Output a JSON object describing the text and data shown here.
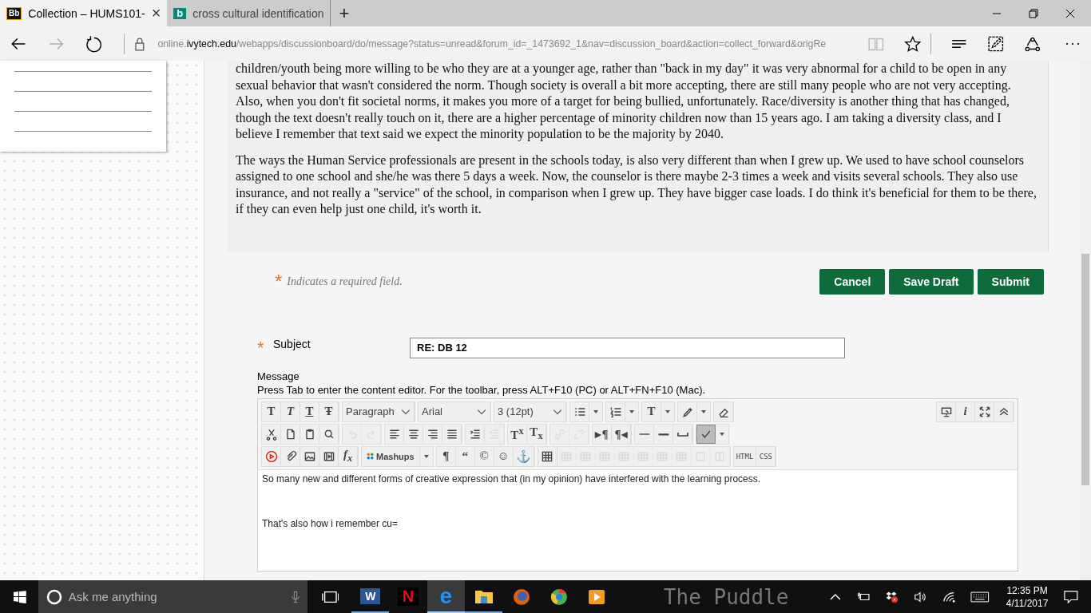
{
  "browser": {
    "tabs": [
      {
        "badge": "Bb",
        "title": "Collection – HUMS101-",
        "selected": true,
        "close": "×"
      },
      {
        "badge": "b",
        "title": "cross cultural identification",
        "selected": false
      }
    ],
    "new_tab": "+",
    "address": {
      "prefix": "online.",
      "domain": "ivytech.edu",
      "path": "/webapps/discussionboard/do/message?status=unread&forum_id=_1473692_1&nav=discussion_board&action=collect_forward&origRe"
    },
    "more": "···"
  },
  "post": {
    "paragraphs": [
      "children/youth being more willing to be who they are at a younger age, rather than \"back in my day\" it was very abnormal for a child to be open in any sexual behavior that wasn't considered the norm. Though society is overall a bit more accepting, there are still many people who are not very accepting. Also, when you don't fit societal norms, it makes you more of a target for being bullied, unfortunately. Race/diversity is another thing that has changed, though the text doesn't really touch on it, there are a higher percentage of minority children now than 15 years ago. I am taking a diversity class, and I believe I remember that text said we expect the minority population to be the majority by 2040.",
      "The ways the Human Service professionals are present in the schools today, is also very different than when I grew up. We used to have school counselors assigned to one school and she/he was there 5 days a week. Now, the counselor is there maybe 2-3 times a week and visits several schools. They also use insurance, and not really a \"service\" of the school, in comparison when I grew up. They have bigger case loads. I do think it's beneficial for them to be there, if they can even help just one child, it's worth it."
    ]
  },
  "form": {
    "required_mark": "*",
    "required_note": "Indicates a required field.",
    "buttons": [
      "Cancel",
      "Save Draft",
      "Submit"
    ],
    "subject": {
      "mark": "*",
      "label": "Subject",
      "value": "RE: DB 12"
    },
    "message": {
      "label": "Message",
      "hint": "Press Tab to enter the content editor. For the toolbar, press ALT+F10 (PC) or ALT+FN+F10 (Mac)."
    }
  },
  "toolbar": {
    "rows": [
      {
        "groups": [
          [
            {
              "kind": "glyph",
              "glyph": "T",
              "disabled": false
            },
            {
              "kind": "glyph",
              "glyph": "T",
              "disabled": false
            },
            {
              "kind": "glyph",
              "glyph": "T",
              "disabled": false
            },
            {
              "kind": "glyph",
              "glyph": "Ŧ",
              "disabled": false
            }
          ],
          [
            {
              "kind": "select",
              "glyph": "Paragraph",
              "disabled": false
            }
          ],
          [
            {
              "kind": "select",
              "glyph": "Arial",
              "disabled": false
            }
          ],
          [
            {
              "kind": "select",
              "glyph": "3 (12pt)",
              "disabled": false
            }
          ],
          [
            {
              "kind": "icon",
              "split": true,
              "disabled": false
            }
          ],
          [
            {
              "kind": "icon",
              "split": true,
              "disabled": false
            }
          ],
          [
            {
              "kind": "glyph",
              "glyph": "T",
              "split": true,
              "disabled": false
            }
          ],
          [
            {
              "kind": "icon",
              "split": true,
              "disabled": false
            }
          ],
          [
            {
              "kind": "icon",
              "disabled": false
            }
          ]
        ],
        "right": [
          [
            {
              "kind": "icon",
              "disabled": false
            },
            {
              "kind": "glyph",
              "glyph": "i",
              "disabled": false
            },
            {
              "kind": "icon",
              "disabled": false
            },
            {
              "kind": "icon",
              "disabled": false
            }
          ]
        ]
      },
      {
        "groups": [
          [
            {
              "kind": "icon",
              "disabled": false
            },
            {
              "kind": "icon",
              "disabled": false
            },
            {
              "kind": "icon",
              "disabled": false
            },
            {
              "kind": "icon",
              "disabled": false
            }
          ],
          [
            {
              "kind": "icon",
              "disabled": true
            },
            {
              "kind": "icon",
              "disabled": true
            }
          ],
          [
            {
              "kind": "icon",
              "disabled": false
            },
            {
              "kind": "icon",
              "disabled": false
            },
            {
              "kind": "icon",
              "disabled": false
            },
            {
              "kind": "icon",
              "disabled": false
            }
          ],
          [
            {
              "kind": "icon",
              "disabled": false
            },
            {
              "kind": "icon",
              "disabled": true
            }
          ],
          [
            {
              "kind": "glyph",
              "glyph": "T$^{x}$",
              "disabled": false
            },
            {
              "kind": "glyph",
              "glyph": "T$_{x}$",
              "disabled": false
            }
          ],
          [
            {
              "kind": "icon",
              "disabled": true
            },
            {
              "kind": "icon",
              "disabled": true
            }
          ],
          [
            {
              "kind": "glyph",
              "glyph": "▸¶",
              "disabled": false
            },
            {
              "kind": "glyph",
              "glyph": "¶◂",
              "disabled": false
            }
          ],
          [
            {
              "kind": "icon",
              "disabled": false
            },
            {
              "kind": "icon",
              "disabled": false
            },
            {
              "kind": "icon",
              "disabled": false
            }
          ],
          [
            {
              "kind": "icon",
              "split": true,
              "pressed": true,
              "disabled": false
            }
          ]
        ]
      },
      {
        "groups": [
          [
            {
              "kind": "icon",
              "disabled": false
            },
            {
              "kind": "icon",
              "disabled": false
            },
            {
              "kind": "icon",
              "disabled": false
            },
            {
              "kind": "icon",
              "disabled": false
            },
            {
              "kind": "glyph",
              "glyph": "f$_{x}$",
              "disabled": false
            }
          ],
          [
            {
              "kind": "menu",
              "glyph": "Mashups",
              "split": true,
              "disabled": false
            }
          ],
          [
            {
              "kind": "glyph",
              "glyph": "¶",
              "disabled": false
            },
            {
              "kind": "glyph",
              "glyph": "“",
              "disabled": false
            },
            {
              "kind": "glyph",
              "glyph": "©",
              "disabled": false
            },
            {
              "kind": "glyph",
              "glyph": "☺",
              "disabled": false
            },
            {
              "kind": "glyph",
              "glyph": "⚓",
              "disabled": false
            }
          ],
          [
            {
              "kind": "icon",
              "disabled": false
            },
            {
              "kind": "icon",
              "disabled": true
            },
            {
              "kind": "icon",
              "disabled": true
            },
            {
              "kind": "icon",
              "disabled": true
            },
            {
              "kind": "icon",
              "disabled": true
            },
            {
              "kind": "icon",
              "disabled": true
            },
            {
              "kind": "icon",
              "disabled": true
            },
            {
              "kind": "icon",
              "disabled": true
            },
            {
              "kind": "icon",
              "disabled": true
            },
            {
              "kind": "icon",
              "disabled": true
            }
          ],
          [
            {
              "kind": "glyph",
              "glyph": "HTML",
              "disabled": false
            },
            {
              "kind": "glyph",
              "glyph": "CSS",
              "disabled": false
            }
          ]
        ]
      }
    ]
  },
  "editor": {
    "lines": [
      "So many new and different forms of creative expression that (in my opinion) have interfered with the learning process.",
      "That's also how i remember cu="
    ]
  },
  "taskbar": {
    "search_placeholder": "Ask me anything",
    "apps": [
      {
        "letter": "W",
        "running": true,
        "selected": false
      },
      {
        "letter": "N",
        "running": false,
        "selected": false
      },
      {
        "letter": "e",
        "running": true,
        "selected": true
      },
      {
        "running": true,
        "selected": false
      },
      {
        "running": false,
        "selected": false
      },
      {
        "running": false,
        "selected": false
      },
      {
        "running": false,
        "selected": false
      }
    ],
    "wallpaper_text": "The Puddle",
    "time": "12:35 PM",
    "date": "4/11/2017"
  }
}
